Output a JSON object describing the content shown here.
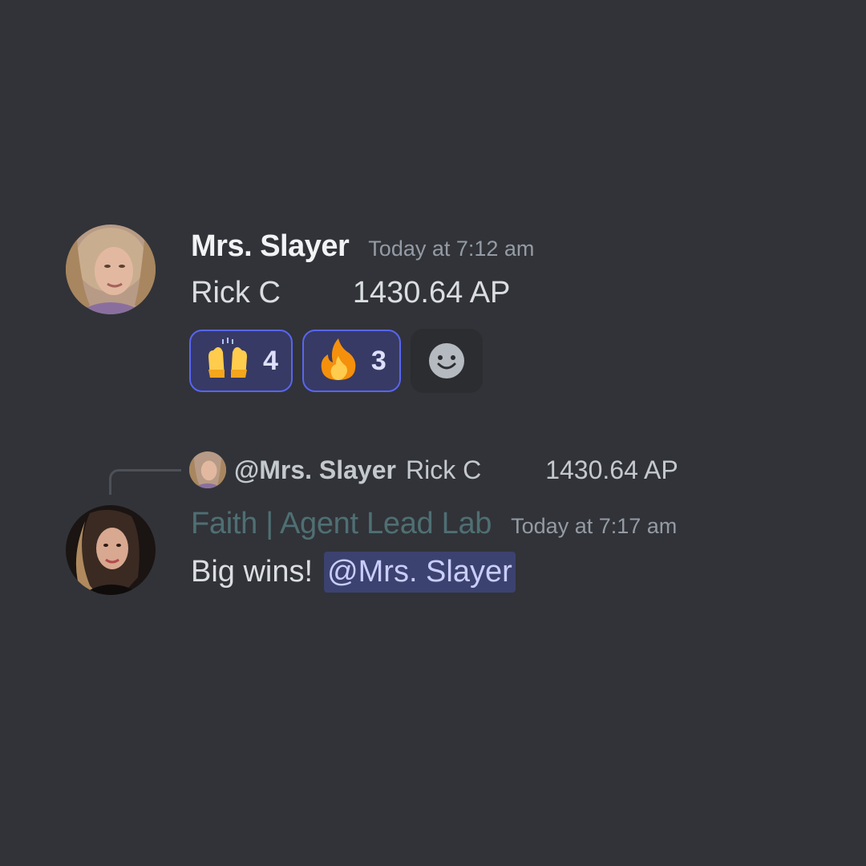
{
  "messages": [
    {
      "author": "Mrs. Slayer",
      "timestamp": "Today at 7:12 am",
      "content_name": "Rick C",
      "content_value": "1430.64 AP",
      "reactions": [
        {
          "emoji": "🙌",
          "emoji_name": "raising-hands-icon",
          "count": "4"
        },
        {
          "emoji": "🔥",
          "emoji_name": "fire-icon",
          "count": "3"
        }
      ]
    },
    {
      "reply_to": {
        "author": "@Mrs. Slayer",
        "text_name": "Rick C",
        "text_value": "1430.64 AP"
      },
      "author": "Faith | Agent Lead Lab",
      "timestamp": "Today at 7:17 am",
      "content": "Big wins!",
      "mention": "@Mrs. Slayer"
    }
  ],
  "colors": {
    "background": "#313338",
    "reaction_border": "#5865f2",
    "reaction_bg": "#373a64",
    "mention_bg": "#3c4270",
    "author2_color": "#4f6f73"
  }
}
